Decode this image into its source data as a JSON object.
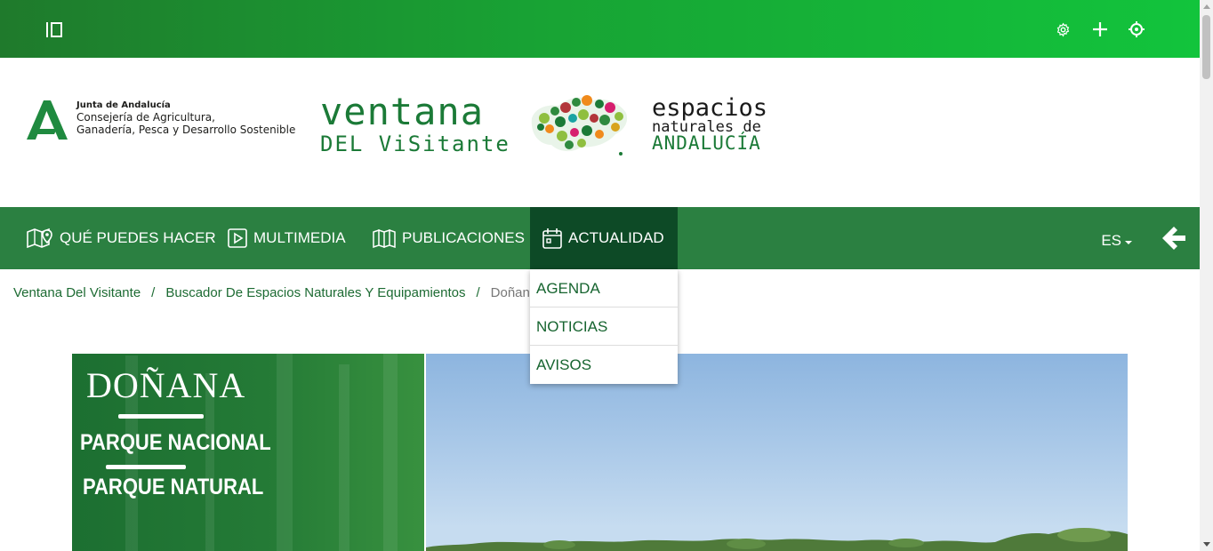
{
  "topbar": {
    "icons": [
      "sidebar-toggle-icon",
      "settings-icon",
      "plus-icon",
      "crosshair-icon"
    ]
  },
  "header": {
    "junta": {
      "name": "Junta de Andalucía",
      "consejeria_line1": "Consejería de Agricultura,",
      "consejeria_line2": "Ganadería, Pesca y Desarrollo Sostenible"
    },
    "ventana": {
      "title": "ventana",
      "subtitle": "DEL ViSitante"
    },
    "espacios": {
      "line1": "espacios",
      "line2": "naturales de",
      "line3": "ANDALUCÍA"
    }
  },
  "nav": {
    "items": [
      {
        "label": "QUÉ PUEDES HACER",
        "icon": "map-pin-icon"
      },
      {
        "label": "MULTIMEDIA",
        "icon": "play-icon"
      },
      {
        "label": "PUBLICACIONES",
        "icon": "book-icon"
      },
      {
        "label": "ACTUALIDAD",
        "icon": "calendar-icon"
      }
    ],
    "language": "ES",
    "back_icon": "arrow-left-icon"
  },
  "dropdown": {
    "items": [
      "AGENDA",
      "NOTICIAS",
      "AVISOS"
    ]
  },
  "breadcrumb": {
    "items": [
      "Ventana Del Visitante",
      "Buscador De Espacios Naturales Y Equipamientos"
    ],
    "separator": "/",
    "current": "Doñana"
  },
  "hero": {
    "title": "DOÑANA",
    "subtitle1": "PARQUE NACIONAL",
    "subtitle2": "PARQUE NATURAL"
  },
  "colors": {
    "topbar_start": "#1f7a2c",
    "topbar_end": "#12c43c",
    "nav_bg": "#2b8041",
    "nav_active": "#0d4a26",
    "brand_green": "#1b7a37"
  }
}
